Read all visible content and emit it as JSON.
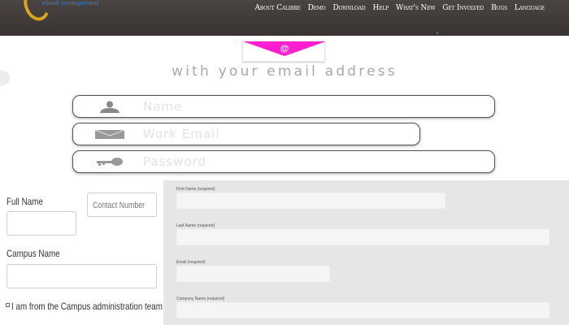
{
  "header": {
    "logo_text": "ebook management",
    "nav": [
      "About Calibre",
      "Demo",
      "Download",
      "Help",
      "What's New",
      "Get Involved",
      "Bugs",
      "Language"
    ]
  },
  "hero": {
    "envelope_icon": "envelope-at-icon",
    "headline": "with your email address"
  },
  "signup": {
    "name_placeholder": "Name",
    "email_placeholder": "Work Email",
    "password_placeholder": "Password"
  },
  "left_form": {
    "full_name_label": "Full Name",
    "contact_placeholder": "Contact Number",
    "campus_label": "Campus Name",
    "checkbox_label": "I am from the Campus administration team"
  },
  "right_form": {
    "first_name_label": "First Name (required)",
    "last_name_label": "Last Name (required)",
    "email_label": "Email (required)",
    "company_label": "Company Name (required)"
  },
  "colors": {
    "topbar": "#3f3a37",
    "accent_pink": "#ff1fd0",
    "logo_gold": "#d8a520",
    "panel_bg": "#e6e6e6"
  }
}
